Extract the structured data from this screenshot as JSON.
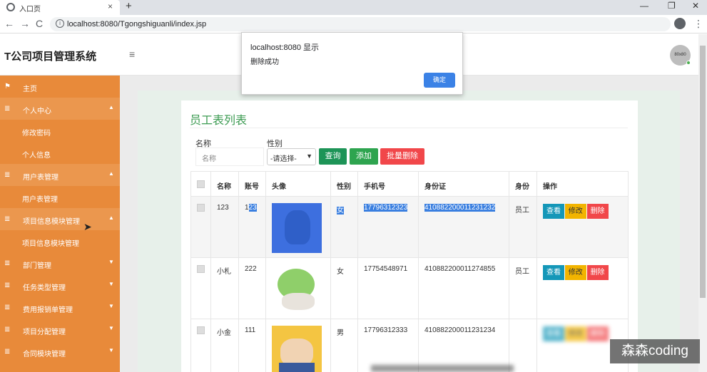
{
  "browser": {
    "tab_title": "入口页",
    "tab_close": "×",
    "new_tab": "+",
    "url": "localhost:8080/Tgongshiguanli/index.jsp",
    "back": "←",
    "forward": "→",
    "reload": "C",
    "star": "☆",
    "menu": "⋮",
    "minimize": "—",
    "restore": "❐",
    "close": "✕"
  },
  "header": {
    "app_title": "T公司项目管理系统",
    "hamburger": "≡",
    "avatar_label": "80x80"
  },
  "sidebar": {
    "items": [
      {
        "label": "主页",
        "type": "top",
        "icon": "flag-icon",
        "glyph": "⚑",
        "arrow": ""
      },
      {
        "label": "个人中心",
        "type": "parent",
        "icon": "list-icon",
        "glyph": "≣",
        "arrow": "▲"
      },
      {
        "label": "修改密码",
        "type": "sub",
        "icon": "",
        "glyph": "",
        "arrow": ""
      },
      {
        "label": "个人信息",
        "type": "sub",
        "icon": "",
        "glyph": "",
        "arrow": ""
      },
      {
        "label": "用户表管理",
        "type": "parent",
        "icon": "list-icon",
        "glyph": "≣",
        "arrow": "▲"
      },
      {
        "label": "用户表管理",
        "type": "sub",
        "icon": "",
        "glyph": "",
        "arrow": ""
      },
      {
        "label": "项目信息模块管理",
        "type": "parent",
        "icon": "list-icon",
        "glyph": "≣",
        "arrow": "▲"
      },
      {
        "label": "项目信息模块管理",
        "type": "sub",
        "icon": "",
        "glyph": "",
        "arrow": ""
      },
      {
        "label": "部门管理",
        "type": "top",
        "icon": "list-icon",
        "glyph": "≣",
        "arrow": "▼"
      },
      {
        "label": "任务类型管理",
        "type": "top",
        "icon": "list-icon",
        "glyph": "≣",
        "arrow": "▼"
      },
      {
        "label": "费用报销单管理",
        "type": "top",
        "icon": "list-icon",
        "glyph": "≣",
        "arrow": "▼"
      },
      {
        "label": "项目分配管理",
        "type": "top",
        "icon": "list-icon",
        "glyph": "≣",
        "arrow": "▼"
      },
      {
        "label": "合同模块管理",
        "type": "top",
        "icon": "list-icon",
        "glyph": "≣",
        "arrow": "▼"
      }
    ]
  },
  "panel": {
    "title": "员工表列表",
    "search": {
      "name_label": "名称",
      "name_placeholder": "名称",
      "sex_label": "性别",
      "sex_selected": "-请选择-",
      "query_btn": "查询",
      "add_btn": "添加",
      "batch_delete_btn": "批量删除"
    },
    "table": {
      "headers": [
        "名称",
        "账号",
        "头像",
        "性别",
        "手机号",
        "身份证",
        "身份",
        "操作"
      ],
      "rows": [
        {
          "name": "123",
          "account_plain": "1",
          "account_hl": "23",
          "sex": "女",
          "phone": "17796312323",
          "idcard": "410882200011231232",
          "role": "员工",
          "photo": "photo-blue"
        },
        {
          "name": "小札",
          "account_plain": "222",
          "account_hl": "",
          "sex": "女",
          "phone": "17754548971",
          "idcard": "410882200011274855",
          "role": "员工",
          "photo": "photo-green"
        },
        {
          "name": "小金",
          "account_plain": "111",
          "account_hl": "",
          "sex": "男",
          "phone": "17796312333",
          "idcard": "410882200011231234",
          "role": "",
          "photo": "photo-yellow"
        }
      ],
      "ops": {
        "view": "查看",
        "edit": "修改",
        "delete": "删除"
      }
    }
  },
  "dialog": {
    "title": "localhost:8080 显示",
    "message": "删除成功",
    "ok": "确定"
  },
  "watermark": "森森coding",
  "colors": {
    "sidebar": "#e88a3a",
    "title_green": "#3c9b52",
    "query": "#1d9457",
    "add": "#2ea44f",
    "danger": "#f1474a",
    "view": "#1497b8",
    "edit": "#f2b400",
    "selection": "#3a7fe0"
  }
}
